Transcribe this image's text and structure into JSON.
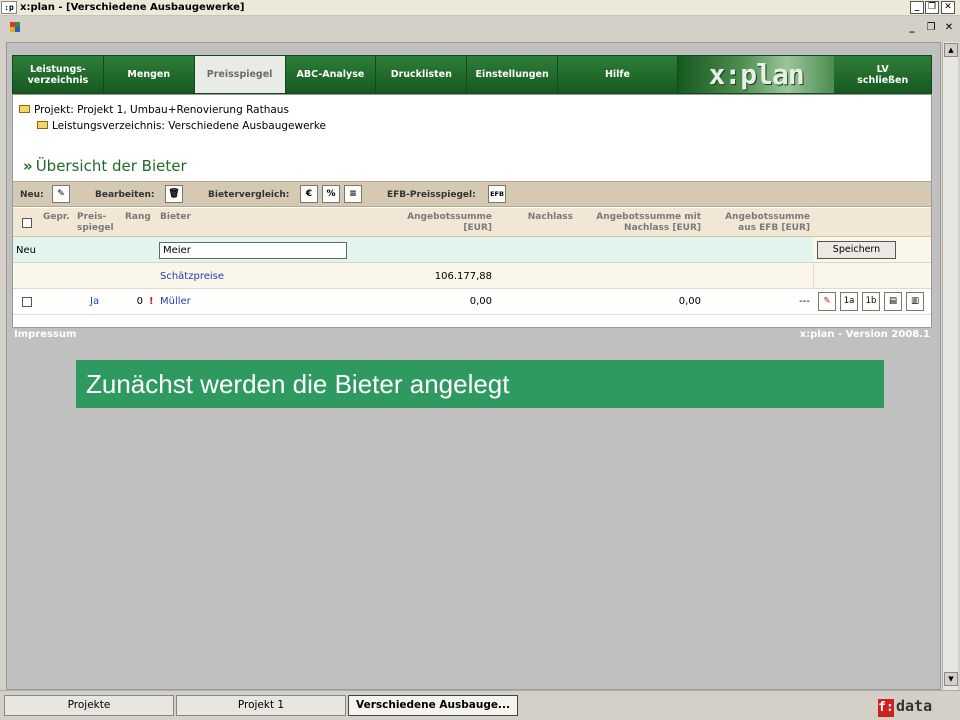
{
  "window": {
    "app_icon_text": ":p",
    "title": "x:plan - [Verschiedene Ausbaugewerke]",
    "minimize": "_",
    "restore": "❐",
    "close": "✕",
    "mdi_minimize": "_",
    "mdi_restore": "❐",
    "mdi_close": "✕"
  },
  "nav": {
    "tabs": [
      {
        "line1": "Leistungs-",
        "line2": "verzeichnis"
      },
      {
        "line1": "Mengen",
        "line2": ""
      },
      {
        "line1": "Preisspiegel",
        "line2": ""
      },
      {
        "line1": "ABC-Analyse",
        "line2": ""
      },
      {
        "line1": "Drucklisten",
        "line2": ""
      },
      {
        "line1": "Einstellungen",
        "line2": ""
      },
      {
        "line1": "Hilfe",
        "line2": ""
      }
    ],
    "logo": "x:plan",
    "close_tab": {
      "line1": "LV",
      "line2": "schließen"
    }
  },
  "breadcrumb": {
    "project": "Projekt: Projekt 1, Umbau+Renovierung Rathaus",
    "lv": "Leistungsverzeichnis: Verschiedene Ausbaugewerke"
  },
  "page_title": "Übersicht der Bieter",
  "toolbar": {
    "neu_label": "Neu:",
    "bearbeiten_label": "Bearbeiten:",
    "vergleich_label": "Bietervergleich:",
    "euro": "€",
    "percent": "%",
    "list": "≡",
    "efb_label": "EFB-Preisspiegel:",
    "efb_btn": "EFB"
  },
  "table": {
    "headers": {
      "gepr": "Gepr.",
      "preisspiegel_1": "Preis-",
      "preisspiegel_2": "spiegel",
      "rang": "Rang",
      "bieter": "Bieter",
      "angebot_1": "Angebotssumme",
      "angebot_2": "[EUR]",
      "nachlass": "Nachlass",
      "mit_nachlass_1": "Angebotssumme mit",
      "mit_nachlass_2": "Nachlass [EUR]",
      "efb_1": "Angebotssumme",
      "efb_2": "aus EFB [EUR]"
    },
    "new_row": {
      "label": "Neu",
      "input_value": "Meier",
      "save": "Speichern"
    },
    "estimate_row": {
      "bieter": "Schätzpreise",
      "angebotssumme": "106.177,88"
    },
    "bidder_row": {
      "preisspiegel": "Ja",
      "rang": "0",
      "warning": "!",
      "bieter": "Müller",
      "angebotssumme": "0,00",
      "mit_nachlass": "0,00",
      "efb": "---",
      "btn_1a": "1a",
      "btn_1b": "1b"
    }
  },
  "footer": {
    "left": "Impressum",
    "right": "x:plan - Version 2008.1"
  },
  "caption": "Zunächst werden die Bieter angelegt",
  "scrollbar": {
    "up": "▲",
    "down": "▼"
  },
  "taskbar": {
    "tabs": [
      "Projekte",
      "Projekt 1",
      "Verschiedene Ausbauge..."
    ],
    "brand_f": "f:",
    "brand_rest": "data"
  },
  "colors": {
    "nav_green": "#1e6a2a",
    "caption_green": "#2e9a60",
    "link_blue": "#1c3fb0",
    "new_row_bg": "#e1f5ee",
    "toolbar_bg": "#d6c9b4"
  }
}
